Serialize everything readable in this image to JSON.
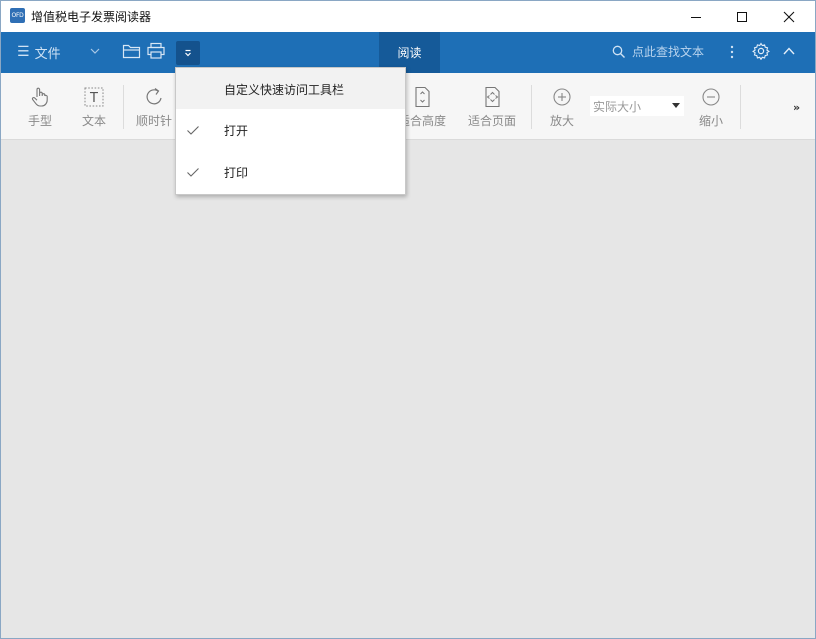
{
  "window": {
    "title": "增值税电子发票阅读器",
    "logo_text": "OFD"
  },
  "ribbon": {
    "file_menu_label": "文件",
    "active_tab": "阅读",
    "search_placeholder": "点此查找文本"
  },
  "toolbar": {
    "tools": [
      {
        "label": "手型",
        "icon": "hand-icon"
      },
      {
        "label": "文本",
        "icon": "text-select-icon"
      },
      {
        "label": "顺时针",
        "icon": "rotate-clockwise-icon"
      },
      {
        "label": "适合高度",
        "icon": "fit-height-icon"
      },
      {
        "label": "适合页面",
        "icon": "fit-page-icon"
      },
      {
        "label": "放大",
        "icon": "zoom-in-icon"
      },
      {
        "label": "缩小",
        "icon": "zoom-out-icon"
      }
    ],
    "zoom_value": "实际大小",
    "overflow_label": "»"
  },
  "quick_access_menu": {
    "header": "自定义快速访问工具栏",
    "items": [
      {
        "label": "打开",
        "checked": true
      },
      {
        "label": "打印",
        "checked": true
      }
    ]
  },
  "colors": {
    "ribbon": "#1e6fb6",
    "active_tab": "#155a99",
    "workspace": "#e6e6e6"
  }
}
